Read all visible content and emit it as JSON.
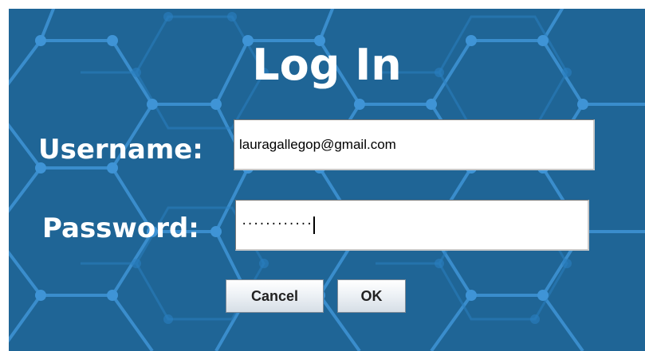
{
  "dialog": {
    "title": "Log In",
    "username_label": "Username:",
    "password_label": "Password:",
    "username_value": "lauragallegop@gmail.com",
    "password_masked": "············",
    "cancel_label": "Cancel",
    "ok_label": "OK"
  },
  "colors": {
    "background": "#1f6596",
    "network_lines": "#3a8fd0",
    "text": "#ffffff"
  }
}
